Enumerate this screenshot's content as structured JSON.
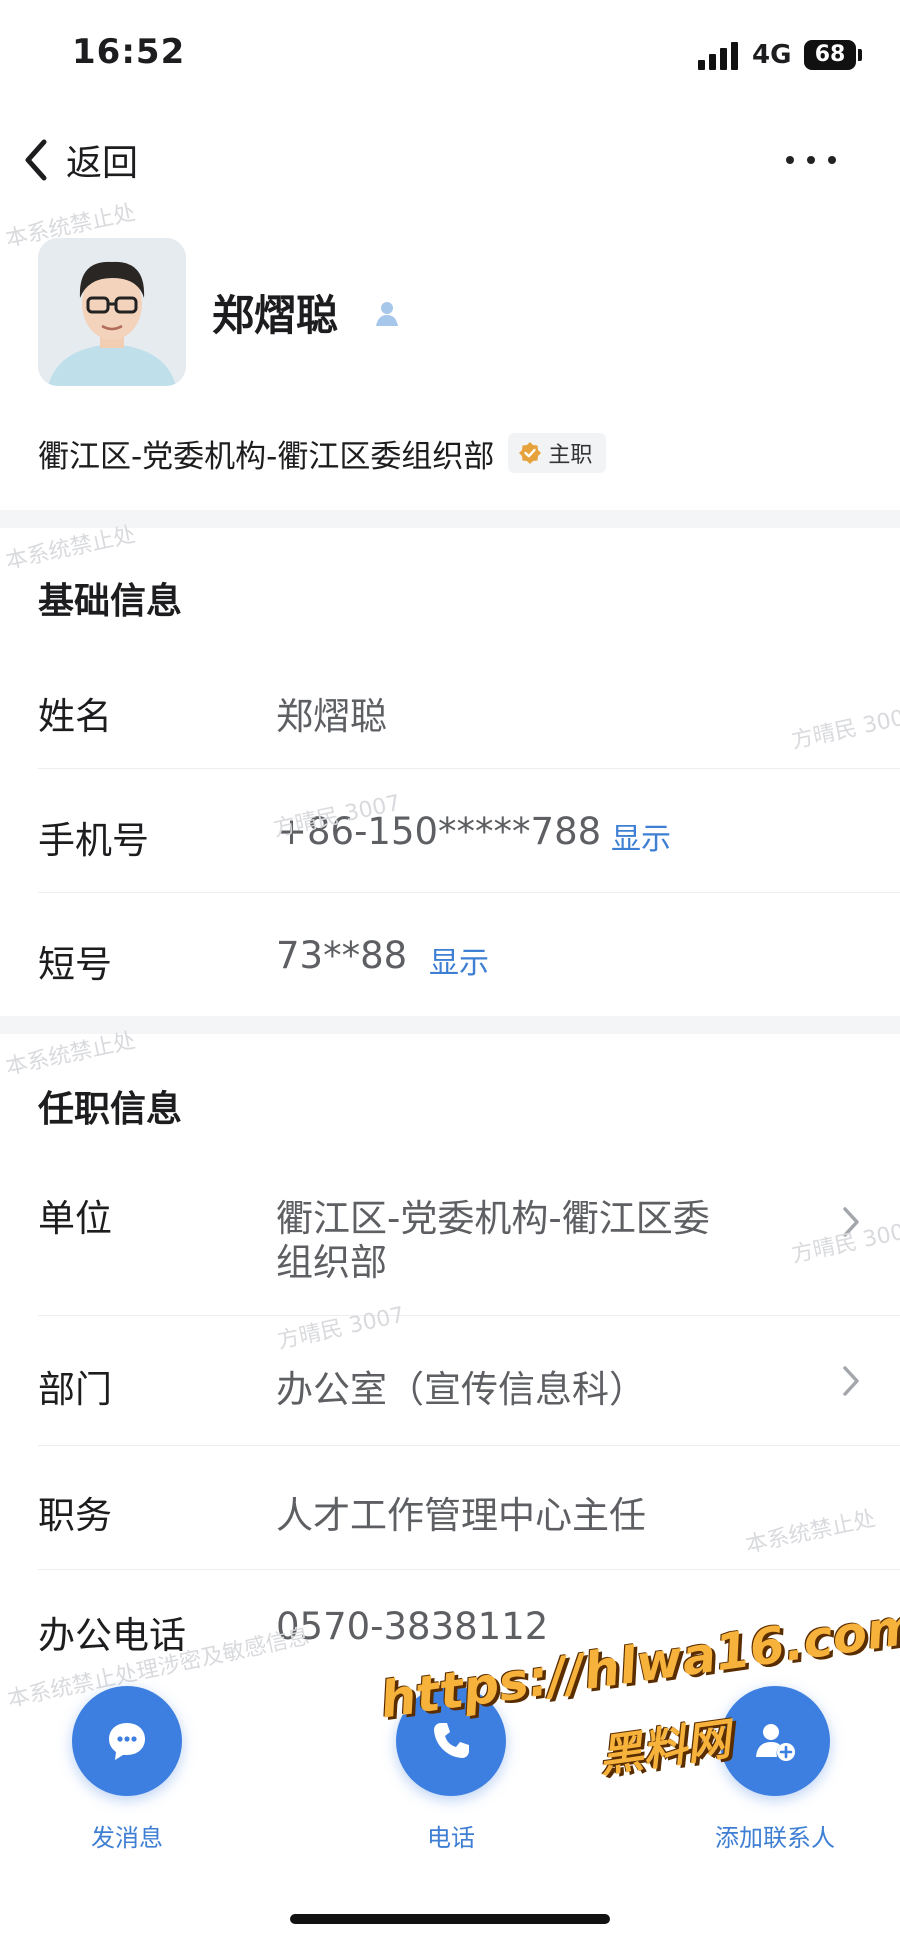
{
  "status_bar": {
    "time": "16:52",
    "network": "4G",
    "battery": "68"
  },
  "nav": {
    "back_label": "返回",
    "more_icon": "more-horizontal-icon",
    "back_icon": "chevron-left-icon"
  },
  "profile": {
    "name": "郑熠聪",
    "org": "衢江区-党委机构-衢江区委组织部",
    "main_badge": "主职",
    "accent": "#3e7fd4"
  },
  "basic_info": {
    "title": "基础信息",
    "name_label": "姓名",
    "name_value": "郑熠聪",
    "phone_label": "手机号",
    "phone_value": "+86-150*****788",
    "phone_show": "显示",
    "short_label": "短号",
    "short_value": "73**88",
    "short_show": "显示"
  },
  "job_info": {
    "title": "任职信息",
    "unit_label": "单位",
    "unit_value_line1": "衢江区-党委机构-衢江区委",
    "unit_value_line2": "组织部",
    "dept_label": "部门",
    "dept_value": "办公室（宣传信息科）",
    "duty_label": "职务",
    "duty_value": "人才工作管理中心主任",
    "office_phone_label": "办公电话",
    "office_phone_value": "0570-3838112"
  },
  "actions": {
    "message": "发消息",
    "call": "电话",
    "add_contact": "添加联系人"
  },
  "watermarks": {
    "system": "本系统禁止处理涉密及敏感信息",
    "system_short": "本系统禁止处",
    "user": "方晴民 3007"
  },
  "overlay": {
    "url": "https://hlwa16.com",
    "site_name": "黑料网"
  }
}
